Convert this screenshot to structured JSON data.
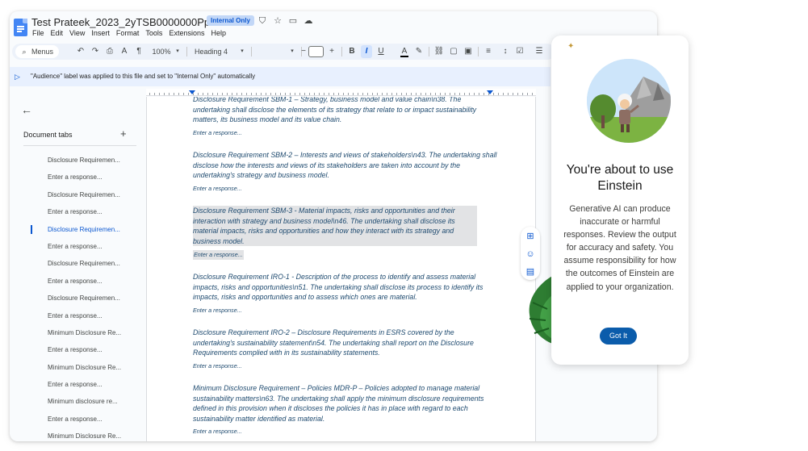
{
  "app": {
    "doc_title": "Test Prateek_2023_2yTSB0000000Ppd2AE",
    "label_badge": "Internal Only",
    "menu": [
      "File",
      "Edit",
      "View",
      "Insert",
      "Format",
      "Tools",
      "Extensions",
      "Help"
    ]
  },
  "toolbar": {
    "menus_label": "Menus",
    "zoom": "100%",
    "style": "Heading 4",
    "font": "",
    "font_size": ""
  },
  "notice": {
    "text": "\"Audience\" label was applied to this file and set to \"Internal Only\" automatically"
  },
  "sidebar": {
    "title": "Document tabs",
    "add_icon": "+",
    "items": [
      {
        "label": "Disclosure Requiremen...",
        "active": false
      },
      {
        "label": "Enter a response...",
        "active": false
      },
      {
        "label": "Disclosure Requiremen...",
        "active": false
      },
      {
        "label": "Enter a response...",
        "active": false
      },
      {
        "label": "Disclosure Requiremen...",
        "active": true
      },
      {
        "label": "Enter a response...",
        "active": false
      },
      {
        "label": "Disclosure Requiremen...",
        "active": false
      },
      {
        "label": "Enter a response...",
        "active": false
      },
      {
        "label": "Disclosure Requiremen...",
        "active": false
      },
      {
        "label": "Enter a response...",
        "active": false
      },
      {
        "label": "Minimum Disclosure Re...",
        "active": false
      },
      {
        "label": "Enter a response...",
        "active": false
      },
      {
        "label": "Minimum Disclosure Re...",
        "active": false
      },
      {
        "label": "Enter a response...",
        "active": false
      },
      {
        "label": "Minimum disclosure re...",
        "active": false
      },
      {
        "label": "Enter a response...",
        "active": false
      },
      {
        "label": "Minimum Disclosure Re...",
        "active": false
      }
    ]
  },
  "document": {
    "blocks": [
      {
        "text": "Disclosure Requirement SBM-1 – Strategy, business model and value chain\\n38. The undertaking shall disclose the elements of its strategy that relate to or impact sustainability matters, its business model and its value   chain.",
        "response": "Enter a response...",
        "highlight": false
      },
      {
        "text": "Disclosure Requirement SBM-2 – Interests and views of stakeholders\\n43. The undertaking shall disclose how the interests and views of its stakeholders are taken into account by the undertaking's strategy and business model.",
        "response": "Enter a response...",
        "highlight": false
      },
      {
        "text": "Disclosure Requirement SBM-3 - Material impacts, risks and opportunities and their interaction with strategy and business model\\n46. The undertaking shall disclose its material impacts, risks and opportunities and how they interact with its strategy and business model.",
        "response": "Enter a response...",
        "highlight": true
      },
      {
        "text": "Disclosure Requirement IRO-1 - Description of the process to identify and assess material impacts, risks and opportunities\\n51. The undertaking shall disclose its process to identify its impacts, risks and opportunities and to assess which ones are   material.",
        "response": "Enter a response...",
        "highlight": false
      },
      {
        "text": "Disclosure Requirement IRO-2 – Disclosure Requirements in ESRS covered by the undertaking's sustainability statement\\n54. The undertaking shall report on the Disclosure Requirements complied with in its sustainability statements.",
        "response": "Enter a response...",
        "highlight": false
      },
      {
        "text": "Minimum Disclosure Requirement – Policies MDR-P – Policies adopted to manage material sustainability matters\\n63. The undertaking shall apply the minimum disclosure requirements defined in this provision when it discloses the policies it has in place with regard to each sustainability matter identified as material.",
        "response": "Enter a response...",
        "highlight": false
      }
    ]
  },
  "einstein": {
    "title": "You're about to use Einstein",
    "body": "Generative AI can produce inaccurate or harmful responses. Review the output for accuracy and safety. You assume responsibility for how the outcomes of Einstein are applied to your organization.",
    "button": "Got It"
  },
  "colors": {
    "accent": "#0b57d0",
    "doc_text": "#1e4a6f",
    "button": "#0b5cab"
  }
}
